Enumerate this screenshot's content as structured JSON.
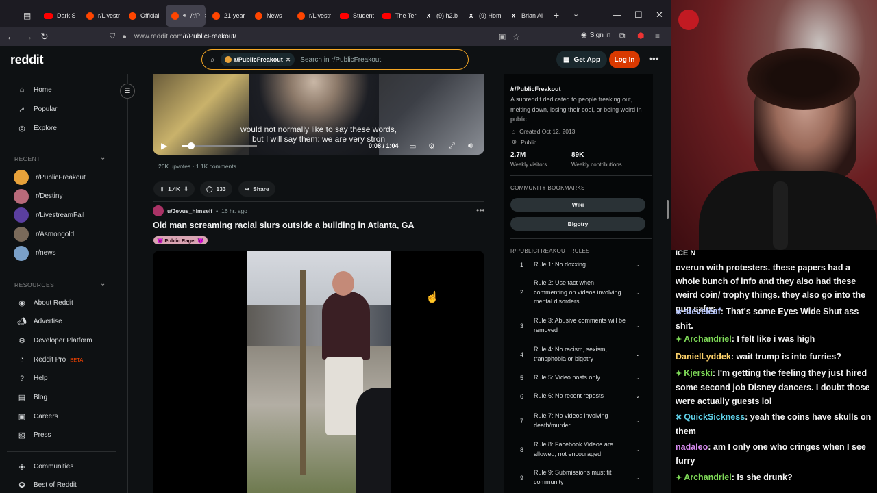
{
  "browser": {
    "tabs": [
      {
        "label": "Dark S",
        "icon": "youtube-icon"
      },
      {
        "label": "r/Livestr",
        "icon": "reddit-icon"
      },
      {
        "label": "Official",
        "icon": "reddit-icon"
      },
      {
        "label": "/r/P",
        "icon": "reddit-icon",
        "active": true
      },
      {
        "label": "21-year",
        "icon": "reddit-icon"
      },
      {
        "label": "News",
        "icon": "reddit-icon"
      },
      {
        "label": "r/Livestr",
        "icon": "reddit-icon"
      },
      {
        "label": "Student",
        "icon": "youtube-icon"
      },
      {
        "label": "The Ter",
        "icon": "youtube-icon"
      },
      {
        "label": "(9) h2.b",
        "icon": "x-icon"
      },
      {
        "label": "(9) Hom",
        "icon": "x-icon"
      },
      {
        "label": "Brian Al",
        "icon": "x-icon"
      }
    ],
    "url_prefix": "www.reddit.com",
    "url_path": "/r/PublicFreakout/",
    "sign_in": "Sign in"
  },
  "header": {
    "logo": "reddit",
    "search_chip": "r/PublicFreakout",
    "search_placeholder": "Search in r/PublicFreakout",
    "get_app": "Get App",
    "log_in": "Log In"
  },
  "leftnav": {
    "main": [
      {
        "label": "Home",
        "icon": "home-icon"
      },
      {
        "label": "Popular",
        "icon": "popular-icon"
      },
      {
        "label": "Explore",
        "icon": "explore-icon"
      }
    ],
    "recent_title": "RECENT",
    "recent": [
      {
        "label": "r/PublicFreakout",
        "color": "#e8a23a"
      },
      {
        "label": "r/Destiny",
        "color": "#b86a7a"
      },
      {
        "label": "r/LivestreamFail",
        "color": "#5b3fa0"
      },
      {
        "label": "r/Asmongold",
        "color": "#7a6a5a"
      },
      {
        "label": "r/news",
        "color": "#7aa0c8"
      }
    ],
    "resources_title": "RESOURCES",
    "resources": [
      {
        "label": "About Reddit",
        "icon": "reddit-icon"
      },
      {
        "label": "Advertise",
        "icon": "advertise-icon"
      },
      {
        "label": "Developer Platform",
        "icon": "developer-icon"
      },
      {
        "label": "Reddit Pro",
        "icon": "reddit-pro-icon",
        "badge": "BETA"
      },
      {
        "label": "Help",
        "icon": "help-icon"
      },
      {
        "label": "Blog",
        "icon": "blog-icon"
      },
      {
        "label": "Careers",
        "icon": "careers-icon"
      },
      {
        "label": "Press",
        "icon": "press-icon"
      }
    ],
    "bottom": [
      {
        "label": "Communities",
        "icon": "communities-icon"
      },
      {
        "label": "Best of Reddit",
        "icon": "best-of-icon"
      }
    ]
  },
  "post1": {
    "subtitle_line1": "would not normally like to say these words,",
    "subtitle_line2": "but I will say them: we are very stron",
    "time": "0:08 / 1:04",
    "progress": 0.125,
    "upvotes": "26K upvotes",
    "comments_count": "1.1K comments",
    "votes": "1.4K",
    "comments": "133",
    "share": "Share"
  },
  "post2": {
    "user": "u/Jevus_himself",
    "age": "16 hr. ago",
    "title": "Old man screaming racial slurs outside a building in Atlanta, GA",
    "flair": "👿 Public Rager 👿"
  },
  "sidebar": {
    "title": "/r/PublicFreakout",
    "description": "A subreddit dedicated to people freaking out, melting down, losing their cool, or being weird in public.",
    "created": "Created Oct 12, 2013",
    "visibility": "Public",
    "visitors_num": "2.7M",
    "visitors_lbl": "Weekly visitors",
    "contrib_num": "89K",
    "contrib_lbl": "Weekly contributions",
    "bookmarks_title": "COMMUNITY BOOKMARKS",
    "bookmarks": [
      "Wiki",
      "Bigotry"
    ],
    "rules_title": "R/PUBLICFREAKOUT RULES",
    "rules": [
      {
        "num": "1",
        "text": "Rule 1: No doxxing"
      },
      {
        "num": "2",
        "text": "Rule 2: Use tact when commenting on videos involving mental disorders"
      },
      {
        "num": "3",
        "text": "Rule 3: Abusive comments will be removed"
      },
      {
        "num": "4",
        "text": "Rule 4: No racism, sexism, transphobia or bigotry"
      },
      {
        "num": "5",
        "text": "Rule 5: Video posts only"
      },
      {
        "num": "6",
        "text": "Rule 6: No recent reposts"
      },
      {
        "num": "7",
        "text": "Rule 7: No videos involving death/murder."
      },
      {
        "num": "8",
        "text": "Rule 8: Facebook Videos are allowed, not encouraged"
      },
      {
        "num": "9",
        "text": "Rule 9: Submissions must fit community"
      }
    ]
  },
  "chat": {
    "partial": "ICE N",
    "messages": [
      {
        "name": "",
        "text": "overun with protesters. these papers had a whole bunch of info and they also had these weird coin/ trophy things. they also go into the gun safes",
        "color": "#f2f2f2"
      },
      {
        "name": "steveleaf",
        "text": ": That's some Eyes Wide Shut ass shit.",
        "color": "#b9c8ff",
        "badge": "❀"
      },
      {
        "name": "Archandriel",
        "text": ": I felt like i was high",
        "color": "#7ed957",
        "badge": "✦"
      },
      {
        "name": "DanielLyddek",
        "text": ": wait trump is into furries?",
        "color": "#ffd36b",
        "badge": ""
      },
      {
        "name": "Kjerski",
        "text": ": I'm getting the feeling they just hired some second job Disney dancers. I doubt those were actually guests lol",
        "color": "#7ed957",
        "badge": "✦"
      },
      {
        "name": "QuickSickness",
        "text": ": yeah the coins have skulls on them",
        "color": "#5fd0e8",
        "badge": "✖"
      },
      {
        "name": "nadaleo",
        "text": ": am I only one who cringes when I see furry",
        "color": "#d88cf0",
        "badge": ""
      },
      {
        "name": "Archandriel",
        "text": ": Is she drunk?",
        "color": "#7ed957",
        "badge": "✦"
      }
    ]
  }
}
